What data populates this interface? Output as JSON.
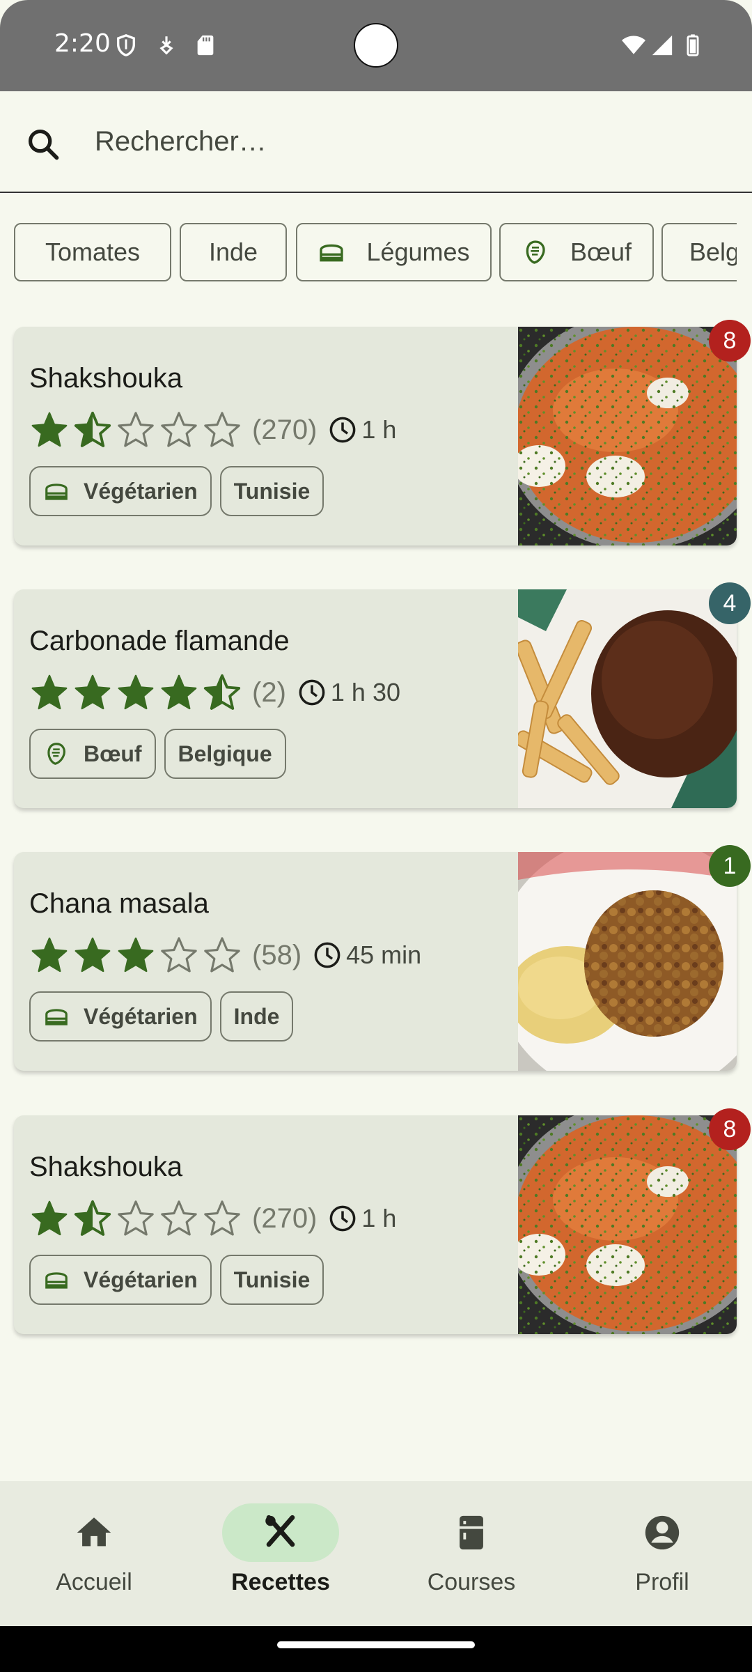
{
  "status_bar": {
    "time": "2:20",
    "icons": [
      "shield-icon",
      "data-saver-icon",
      "sd-card-icon",
      "wifi-icon",
      "signal-icon",
      "battery-icon"
    ]
  },
  "search": {
    "placeholder": "Rechercher…",
    "icon": "search-icon"
  },
  "chips": [
    {
      "label": "Tomates",
      "icon": null
    },
    {
      "label": "Inde",
      "icon": null
    },
    {
      "label": "Légumes",
      "icon": "vegetable-icon"
    },
    {
      "label": "Bœuf",
      "icon": "meat-icon"
    },
    {
      "label": "Belgique",
      "icon": null
    }
  ],
  "recipes": [
    {
      "title": "Shakshouka",
      "rating": 1.5,
      "reviews": "(270)",
      "duration": "1 h",
      "tags": [
        {
          "label": "Végétarien",
          "icon": "vegetable-icon"
        },
        {
          "label": "Tunisie",
          "icon": null
        }
      ],
      "badge": "8",
      "badge_color": "#b3211e",
      "photo": "shakshouka"
    },
    {
      "title": "Carbonade flamande",
      "rating": 4.5,
      "reviews": "(2)",
      "duration": "1 h 30",
      "tags": [
        {
          "label": "Bœuf",
          "icon": "meat-icon"
        },
        {
          "label": "Belgique",
          "icon": null
        }
      ],
      "badge": "4",
      "badge_color": "#366468",
      "photo": "carbonade"
    },
    {
      "title": "Chana masala",
      "rating": 3,
      "reviews": "(58)",
      "duration": "45 min",
      "tags": [
        {
          "label": "Végétarien",
          "icon": "vegetable-icon"
        },
        {
          "label": "Inde",
          "icon": null
        }
      ],
      "badge": "1",
      "badge_color": "#386a20",
      "photo": "chana"
    },
    {
      "title": "Shakshouka",
      "rating": 1.5,
      "reviews": "(270)",
      "duration": "1 h",
      "tags": [
        {
          "label": "Végétarien",
          "icon": "vegetable-icon"
        },
        {
          "label": "Tunisie",
          "icon": null
        }
      ],
      "badge": "8",
      "badge_color": "#b3211e",
      "photo": "shakshouka"
    }
  ],
  "bottom_nav": {
    "items": [
      {
        "label": "Accueil",
        "icon": "home-icon",
        "active": false
      },
      {
        "label": "Recettes",
        "icon": "cutlery-icon",
        "active": true
      },
      {
        "label": "Courses",
        "icon": "fridge-icon",
        "active": false
      },
      {
        "label": "Profil",
        "icon": "account-icon",
        "active": false
      }
    ]
  },
  "colors": {
    "star_fill": "#386a20",
    "active_nav": "#cbe8c8",
    "card_bg": "#e4e8dc"
  }
}
